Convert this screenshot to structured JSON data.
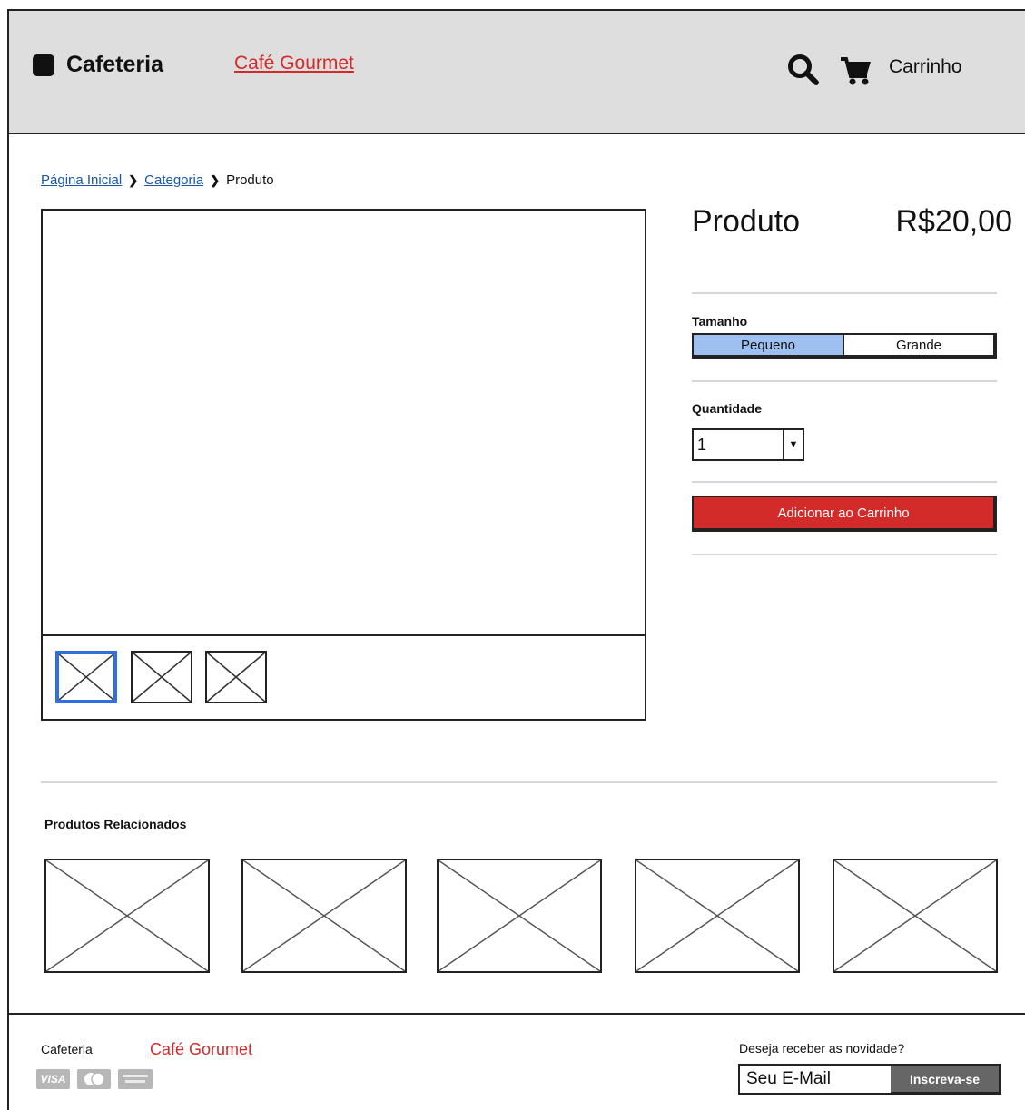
{
  "header": {
    "brand": "Cafeteria",
    "brand_link": "Café Gourmet",
    "cart_label": "Carrinho"
  },
  "breadcrumb": {
    "home": "Página Inicial",
    "category": "Categoria",
    "current": "Produto"
  },
  "product": {
    "name": "Produto",
    "price": "R$20,00",
    "size_label": "Tamanho",
    "sizes": [
      "Pequeno",
      "Grande"
    ],
    "selected_size": "Pequeno",
    "quantity_label": "Quantidade",
    "quantity_value": "1",
    "add_to_cart": "Adicionar ao Carrinho"
  },
  "gallery": {
    "thumbnails": 3,
    "active_thumbnail": 1
  },
  "related": {
    "title": "Produtos Relacionados",
    "count": 5
  },
  "footer": {
    "brand": "Cafeteria",
    "brand_link": "Café Gorumet",
    "payment_icons": [
      "visa-icon",
      "mastercard-icon",
      "american-express-icon"
    ],
    "visa_text": "VISA",
    "newsletter_label": "Deseja receber as novidade?",
    "email_placeholder": "Seu E-Mail",
    "subscribe_label": "Inscreva-se"
  },
  "colors": {
    "header_bg": "#dedede",
    "accent_red": "#d32a2a",
    "selected_size_bg": "#9ec0f1",
    "active_thumb_border": "#2f6fe0",
    "link_blue": "#1a56a8"
  }
}
